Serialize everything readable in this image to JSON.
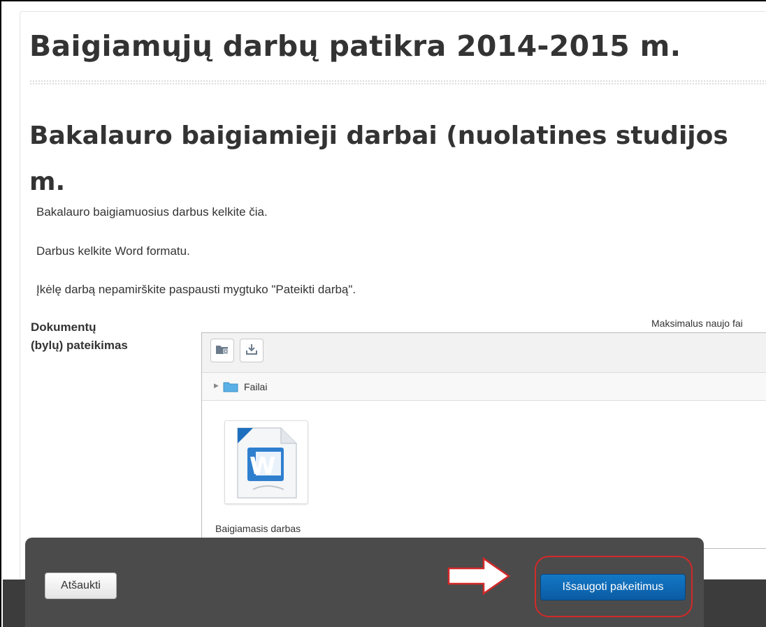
{
  "page": {
    "title": "Baigiamųjų darbų patikra 2014-2015 m.",
    "section_title_line1": "Bakalauro baigiamieji darbai (nuolatines studijos",
    "section_title_line2": "m."
  },
  "intro": {
    "lines": [
      "Bakalauro baigiamuosius darbus kelkite čia.",
      "Darbus kelkite Word formatu.",
      "Įkėlę darbą nepamirškite paspausti mygtuko \"Pateikti darbą\"."
    ]
  },
  "form": {
    "field_label_line1": "Dokumentų",
    "field_label_line2": "(bylų) pateikimas",
    "max_size_text": "Maksimalus naujo fai"
  },
  "filemanager": {
    "toolbar": {
      "buttons": [
        {
          "icon": "folder-add-icon"
        },
        {
          "icon": "download-icon"
        }
      ]
    },
    "path": {
      "folder_label": "Failai"
    },
    "files": [
      {
        "name": "Baigiamasis darbas",
        "icon": "word-document-icon"
      }
    ]
  },
  "footer": {
    "cancel_label": "Atšaukti",
    "save_label": "Išsaugoti pakeitimus"
  },
  "colors": {
    "save_button": "#0a5ba3",
    "highlight": "#d32929",
    "footer_bg": "#4b4b4b"
  }
}
